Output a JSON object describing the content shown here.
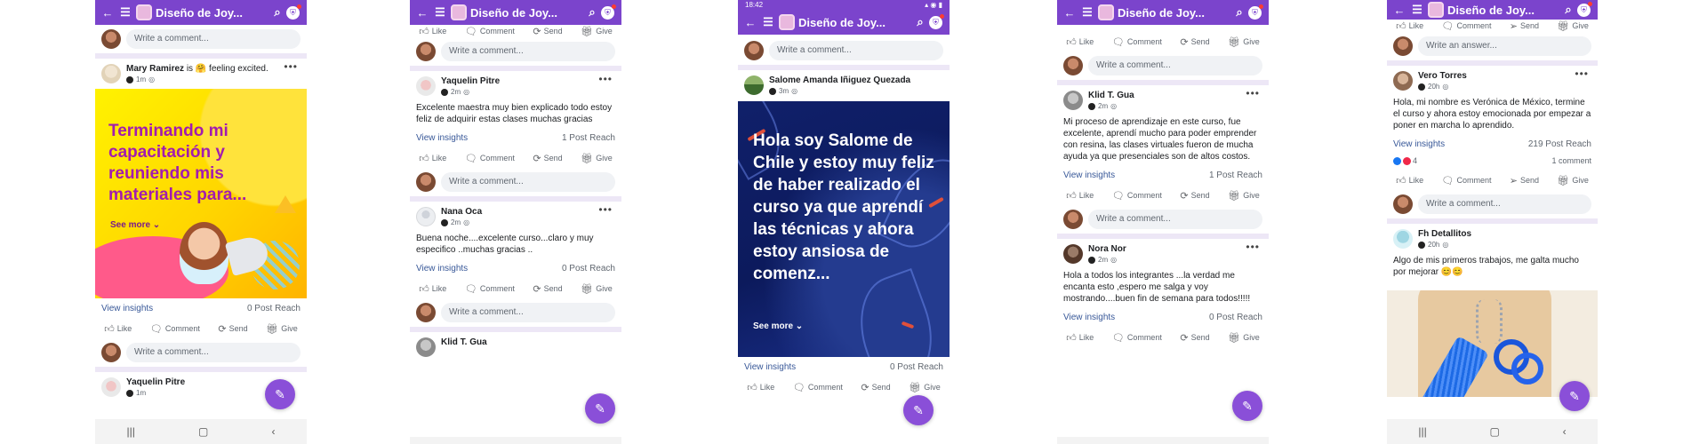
{
  "app": {
    "group_title": "Diseño de Joy...",
    "status_time": "18:42"
  },
  "common": {
    "write_comment": "Write a comment...",
    "write_answer": "Write an answer...",
    "view_insights": "View insights",
    "like": "Like",
    "comment": "Comment",
    "send": "Send",
    "give": "Give",
    "see_more": "See more"
  },
  "screen1": {
    "post1": {
      "author": "Mary Ramirez",
      "feeling": "is 🤗 feeling excited.",
      "time": "1m",
      "image_text": "Terminando mi capacitación y reuniendo mis materiales para...",
      "reach": "0 Post Reach"
    },
    "post2": {
      "author": "Yaquelin Pitre",
      "time": "1m"
    }
  },
  "screen2": {
    "post1": {
      "author": "Yaquelin Pitre",
      "time": "2m",
      "text": "Excelente maestra muy bien explicado todo estoy feliz de adquirir estas clases muchas gracias",
      "reach": "1 Post Reach"
    },
    "post2": {
      "author": "Nana Oca",
      "time": "2m",
      "text": "Buena noche....excelente curso...claro y muy especifico ..muchas gracias ..",
      "reach": "0 Post Reach"
    },
    "post3": {
      "author": "Klid T. Gua"
    }
  },
  "screen3": {
    "post1": {
      "author": "Salome Amanda Iñiguez Quezada",
      "time": "3m",
      "image_text": "Hola soy Salome de Chile y estoy muy feliz de haber realizado el curso ya que aprendí las técnicas y ahora estoy ansiosa de comenz...",
      "reach": "0 Post Reach"
    }
  },
  "screen4": {
    "post1": {
      "author": "Klid T. Gua",
      "time": "2m",
      "text": "Mi proceso de aprendizaje en este curso, fue excelente, aprendí mucho para poder emprender con resina, las clases virtuales fueron de mucha ayuda ya que presenciales son de altos costos.",
      "reach": "1 Post Reach"
    },
    "post2": {
      "author": "Nora Nor",
      "time": "2m",
      "text": "Hola a todos los integrantes ...la verdad me encanta esto ,espero me salga y voy mostrando....buen fin de semana para todos!!!!!",
      "reach": "0 Post Reach"
    }
  },
  "screen5": {
    "post1": {
      "author": "Vero Torres",
      "time": "20h",
      "text": "Hola, mi nombre es Verónica de México, termine el curso y ahora estoy emocionada por empezar a poner en marcha lo aprendido.",
      "reach": "219 Post Reach",
      "reaction_count": "4",
      "comment_count": "1 comment"
    },
    "post2": {
      "author": "Fh Detallitos",
      "time": "20h",
      "text": "Algo de mis primeros trabajos, me galta mucho por mejorar 😊😊"
    }
  },
  "colors": {
    "brand_purple": "#7b44cc",
    "fab_purple": "#8a4fd8",
    "link_blue": "#385898"
  }
}
